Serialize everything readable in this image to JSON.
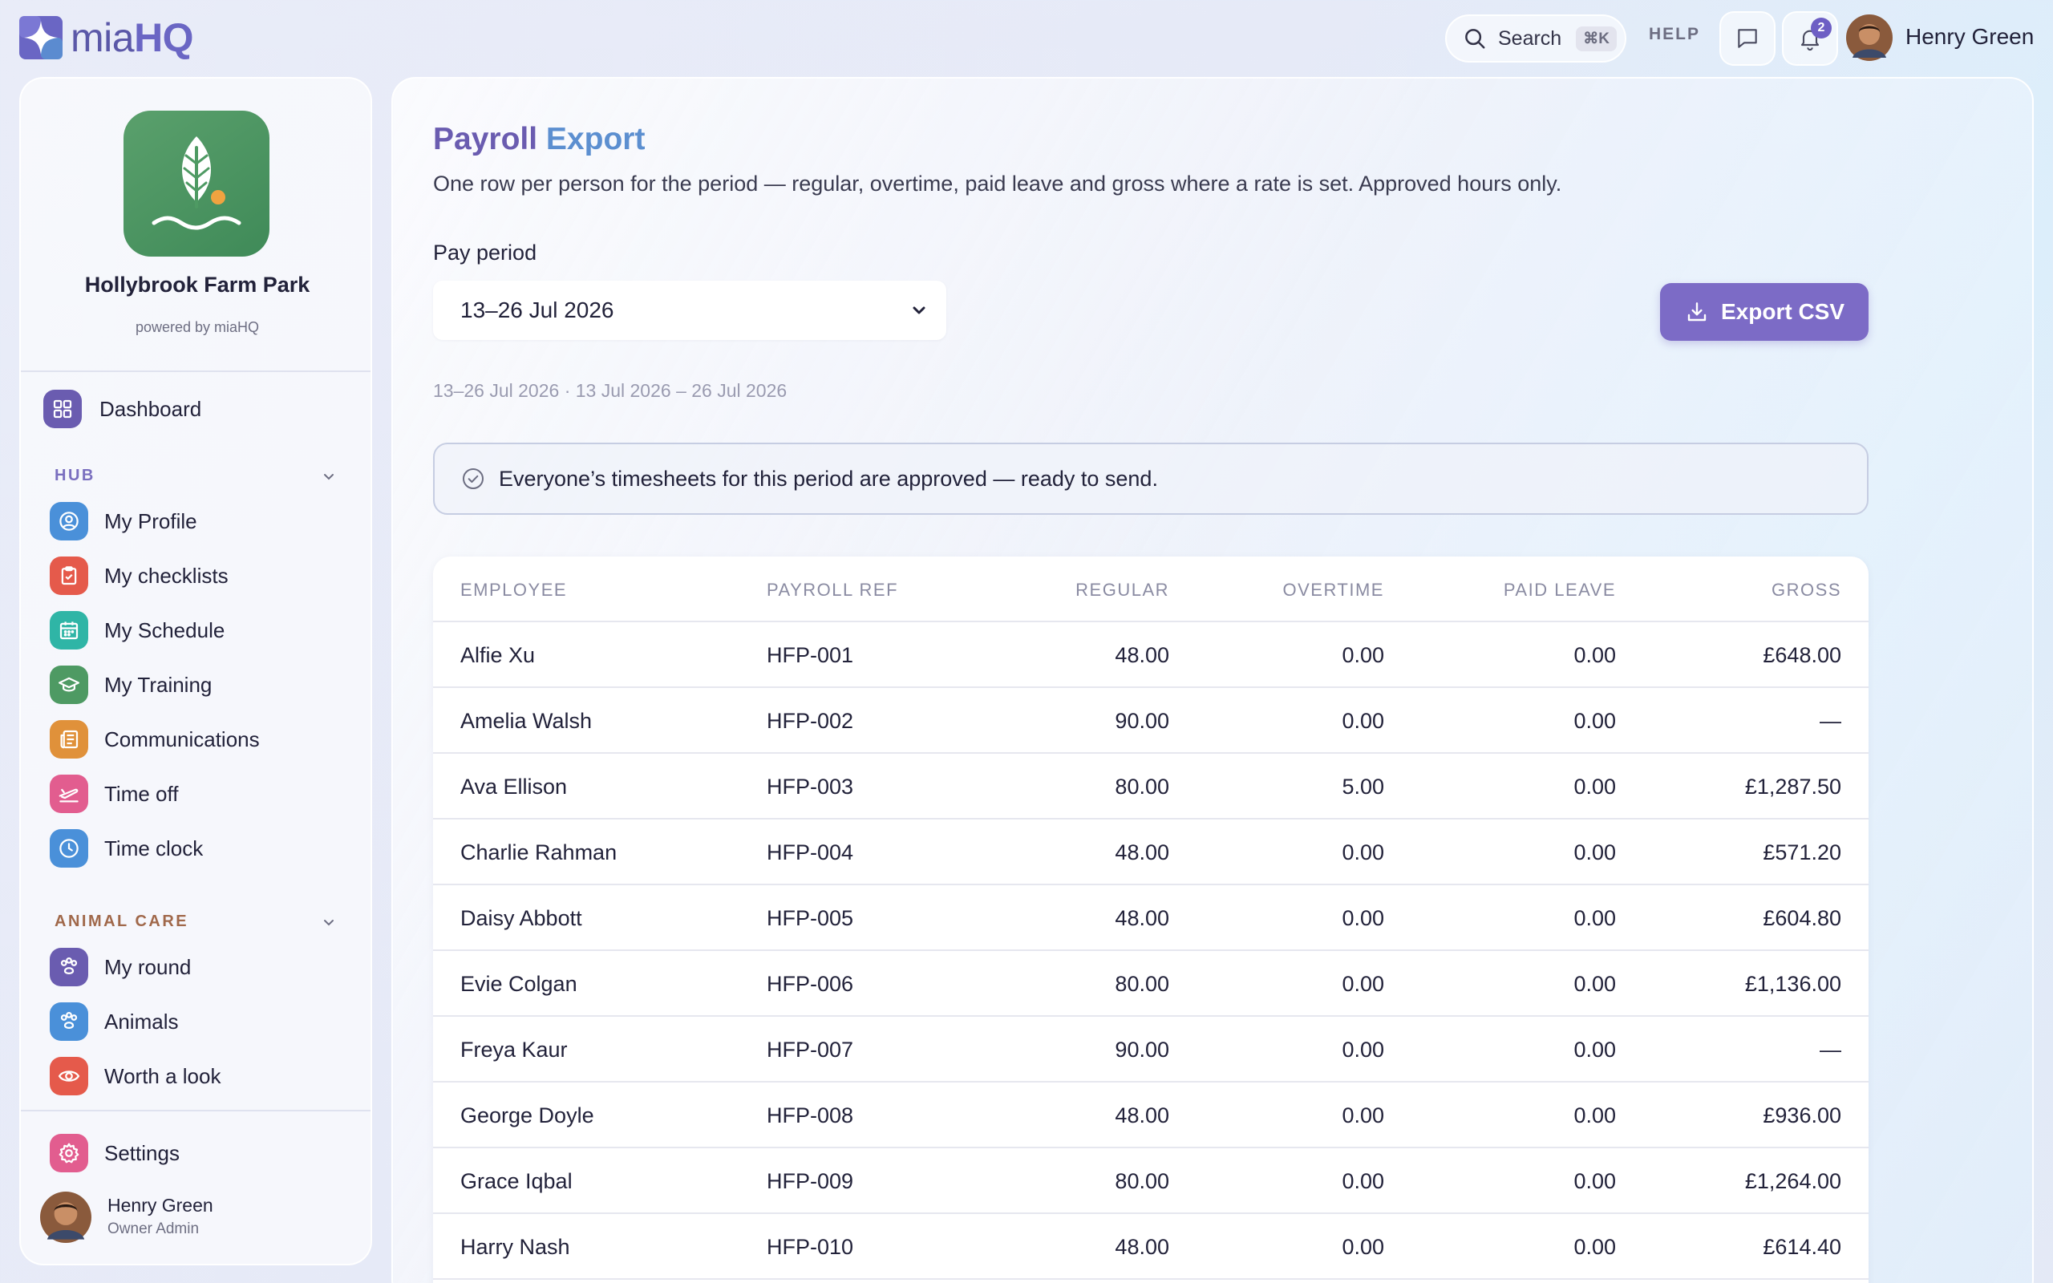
{
  "app": {
    "name_part1": "mia",
    "name_part2": "HQ"
  },
  "topbar": {
    "search_label": "Search",
    "search_shortcut": "⌘K",
    "help_label": "HELP",
    "notification_count": "2",
    "user_name": "Henry Green"
  },
  "sidebar": {
    "org_name": "Hollybrook Farm Park",
    "powered_by": "powered by miaHQ",
    "dashboard_label": "Dashboard",
    "hub_header": "HUB",
    "hub_items": [
      {
        "label": "My Profile",
        "icon": "user-circle-icon",
        "color": "#4a90d9"
      },
      {
        "label": "My checklists",
        "icon": "clipboard-check-icon",
        "color": "#e55a4b"
      },
      {
        "label": "My Schedule",
        "icon": "calendar-icon",
        "color": "#2fb5a6"
      },
      {
        "label": "My Training",
        "icon": "graduation-cap-icon",
        "color": "#4e9a63"
      },
      {
        "label": "Communications",
        "icon": "newspaper-icon",
        "color": "#e0913a"
      },
      {
        "label": "Time off",
        "icon": "plane-icon",
        "color": "#e25d8f"
      },
      {
        "label": "Time clock",
        "icon": "clock-icon",
        "color": "#4a90d9"
      }
    ],
    "animal_header": "ANIMAL CARE",
    "animal_items": [
      {
        "label": "My round",
        "icon": "paw-icon",
        "color": "#6a5cb0"
      },
      {
        "label": "Animals",
        "icon": "paw-icon",
        "color": "#4a90d9"
      },
      {
        "label": "Worth a look",
        "icon": "eye-icon",
        "color": "#e55a4b"
      }
    ],
    "settings_label": "Settings",
    "user_name": "Henry Green",
    "user_role": "Owner Admin"
  },
  "page": {
    "title_part1": "Payroll",
    "title_part2": "Export",
    "subtitle": "One row per person for the period — regular, overtime, paid leave and gross where a rate is set. Approved hours only.",
    "pay_period_label": "Pay period",
    "pay_period_value": "13–26 Jul 2026",
    "export_label": "Export CSV",
    "period_meta": "13–26 Jul 2026 · 13 Jul 2026 – 26 Jul 2026",
    "alert_text": "Everyone’s timesheets for this period are approved — ready to send."
  },
  "table": {
    "headers": {
      "employee": "EMPLOYEE",
      "ref": "PAYROLL REF",
      "regular": "REGULAR",
      "overtime": "OVERTIME",
      "paid_leave": "PAID LEAVE",
      "gross": "GROSS"
    },
    "rows": [
      {
        "employee": "Alfie Xu",
        "ref": "HFP-001",
        "regular": "48.00",
        "overtime": "0.00",
        "paid_leave": "0.00",
        "gross": "£648.00"
      },
      {
        "employee": "Amelia Walsh",
        "ref": "HFP-002",
        "regular": "90.00",
        "overtime": "0.00",
        "paid_leave": "0.00",
        "gross": "—"
      },
      {
        "employee": "Ava Ellison",
        "ref": "HFP-003",
        "regular": "80.00",
        "overtime": "5.00",
        "paid_leave": "0.00",
        "gross": "£1,287.50"
      },
      {
        "employee": "Charlie Rahman",
        "ref": "HFP-004",
        "regular": "48.00",
        "overtime": "0.00",
        "paid_leave": "0.00",
        "gross": "£571.20"
      },
      {
        "employee": "Daisy Abbott",
        "ref": "HFP-005",
        "regular": "48.00",
        "overtime": "0.00",
        "paid_leave": "0.00",
        "gross": "£604.80"
      },
      {
        "employee": "Evie Colgan",
        "ref": "HFP-006",
        "regular": "80.00",
        "overtime": "0.00",
        "paid_leave": "0.00",
        "gross": "£1,136.00"
      },
      {
        "employee": "Freya Kaur",
        "ref": "HFP-007",
        "regular": "90.00",
        "overtime": "0.00",
        "paid_leave": "0.00",
        "gross": "—"
      },
      {
        "employee": "George Doyle",
        "ref": "HFP-008",
        "regular": "48.00",
        "overtime": "0.00",
        "paid_leave": "0.00",
        "gross": "£936.00"
      },
      {
        "employee": "Grace Iqbal",
        "ref": "HFP-009",
        "regular": "80.00",
        "overtime": "0.00",
        "paid_leave": "0.00",
        "gross": "£1,264.00"
      },
      {
        "employee": "Harry Nash",
        "ref": "HFP-010",
        "regular": "48.00",
        "overtime": "0.00",
        "paid_leave": "0.00",
        "gross": "£614.40"
      }
    ]
  },
  "colors": {
    "accent": "#7c6bc6",
    "title_purple": "#6a5cb0",
    "title_blue": "#5c8fd0",
    "org_green": "#4e9a63",
    "hub_header": "#7a6fbf",
    "animal_header": "#a0684a"
  }
}
